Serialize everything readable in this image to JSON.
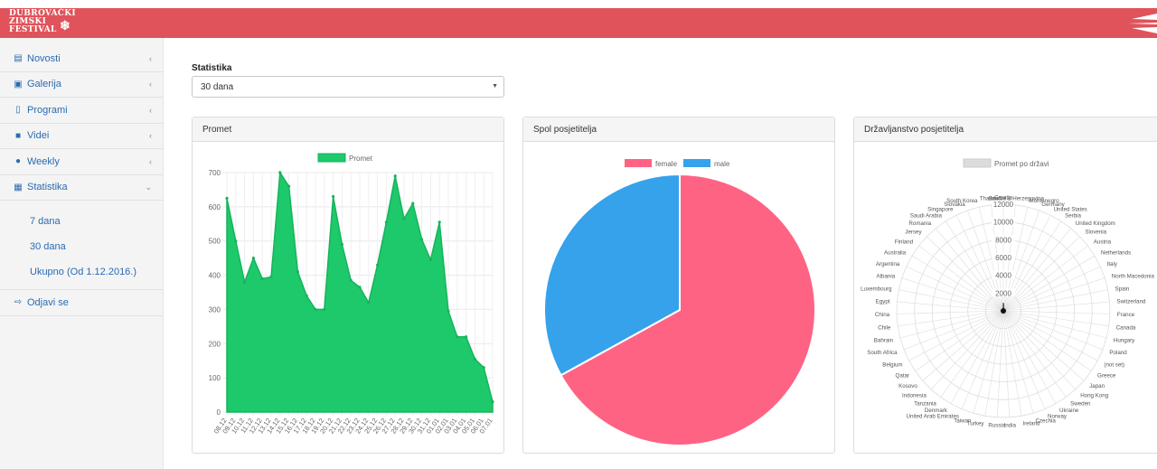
{
  "app": {
    "logo_lines": [
      "DUBROVAČKI",
      "ZIMSKI",
      "FESTIVAL"
    ],
    "logo_glyph": "❄"
  },
  "sidebar": {
    "items": [
      {
        "label": "Novosti",
        "icon": "newspaper-icon",
        "glyph": "▤"
      },
      {
        "label": "Galerija",
        "icon": "image-icon",
        "glyph": "▣"
      },
      {
        "label": "Programi",
        "icon": "file-icon",
        "glyph": "▯"
      },
      {
        "label": "Videi",
        "icon": "video-icon",
        "glyph": "■"
      },
      {
        "label": "Weekly",
        "icon": "info-icon",
        "glyph": "●"
      },
      {
        "label": "Statistika",
        "icon": "table-icon",
        "glyph": "▦"
      }
    ],
    "sub_items": [
      "7 dana",
      "30 dana",
      "Ukupno (Od 1.12.2016.)"
    ],
    "logout": {
      "label": "Odjavi se",
      "icon": "sign-out-icon",
      "glyph": "⇨"
    }
  },
  "main": {
    "section_label": "Statistika",
    "period_select": {
      "value": "30 dana",
      "options_visible": [
        "30 dana"
      ]
    }
  },
  "cards": [
    {
      "title": "Promet"
    },
    {
      "title": "Spol posjetitelja"
    },
    {
      "title": "Državljanstvo posjetitelja"
    }
  ],
  "colors": {
    "brand": "#e0535b",
    "line_fill": "#1ec96b",
    "female": "#ff6384",
    "male": "#36a2eb",
    "radar_fill": "#dcdcdc"
  },
  "chart_data": [
    {
      "type": "area",
      "title": "",
      "legend": [
        "Promet"
      ],
      "legend_position": "top",
      "ylim": [
        0,
        700
      ],
      "yticks": [
        0,
        100,
        200,
        300,
        400,
        500,
        600,
        700
      ],
      "x": [
        "08.12",
        "09.12",
        "10.12",
        "11.12",
        "12.12",
        "13.12",
        "14.12",
        "15.12",
        "16.12",
        "17.12",
        "18.12",
        "19.12",
        "20.12",
        "21.12",
        "22.12",
        "23.12",
        "24.12",
        "25.12",
        "26.12",
        "27.12",
        "28.12",
        "29.12",
        "30.12",
        "31.12",
        "01.01",
        "02.01",
        "03.01",
        "04.01",
        "05.01",
        "06.01",
        "07.01"
      ],
      "series": [
        {
          "name": "Promet",
          "values": [
            625,
            500,
            380,
            450,
            390,
            395,
            700,
            660,
            410,
            340,
            300,
            300,
            630,
            490,
            385,
            365,
            320,
            430,
            555,
            690,
            565,
            610,
            505,
            445,
            555,
            295,
            220,
            220,
            155,
            130,
            30
          ]
        }
      ],
      "grid": true
    },
    {
      "type": "pie",
      "title": "",
      "legend": [
        "female",
        "male"
      ],
      "legend_position": "top",
      "series": [
        {
          "values": [
            67,
            33
          ]
        }
      ],
      "categories": [
        "female",
        "male"
      ]
    },
    {
      "type": "radar",
      "title": "",
      "legend": [
        "Promet po državi"
      ],
      "legend_position": "top",
      "rlim": [
        0,
        12000
      ],
      "rticks": [
        2000,
        4000,
        6000,
        8000,
        10000,
        12000
      ],
      "categories": [
        "Croatia",
        "Bosnia & Herzegovina",
        "Montenegro",
        "Germany",
        "United States",
        "Serbia",
        "United Kingdom",
        "Slovenia",
        "Austria",
        "Netherlands",
        "Italy",
        "North Macedonia",
        "Spain",
        "Switzerland",
        "France",
        "Canada",
        "Hungary",
        "Poland",
        "(not set)",
        "Greece",
        "Japan",
        "Hong Kong",
        "Sweden",
        "Ukraine",
        "Norway",
        "Czechia",
        "Ireland",
        "India",
        "Russia",
        "Turkey",
        "Taiwan",
        "United Arab Emirates",
        "Denmark",
        "Tanzania",
        "Indonesia",
        "Kosovo",
        "Qatar",
        "Belgium",
        "South Africa",
        "Bahrain",
        "Chile",
        "China",
        "Egypt",
        "Luxembourg",
        "Albania",
        "Argentina",
        "Australia",
        "Finland",
        "Jersey",
        "Romania",
        "Saudi Arabia",
        "Singapore",
        "Slovakia",
        "South Korea",
        "Thailand"
      ],
      "series": [
        {
          "name": "Promet po državi",
          "values": [
            900,
            250,
            60,
            60,
            40,
            30,
            30,
            20,
            20,
            15,
            15,
            10,
            10,
            10,
            10,
            8,
            8,
            8,
            8,
            5,
            5,
            5,
            5,
            5,
            5,
            5,
            5,
            5,
            5,
            5,
            5,
            5,
            5,
            5,
            5,
            5,
            5,
            5,
            5,
            5,
            5,
            5,
            5,
            5,
            5,
            5,
            5,
            5,
            5,
            5,
            5,
            5,
            5,
            5,
            5
          ]
        }
      ]
    }
  ]
}
